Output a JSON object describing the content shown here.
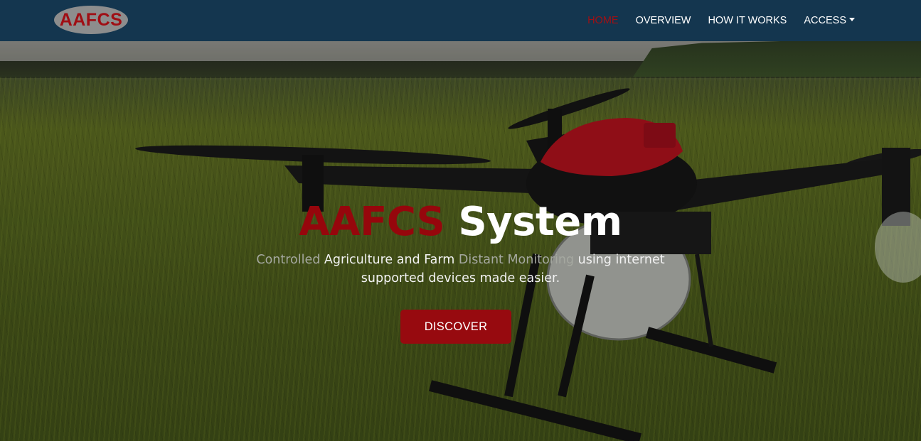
{
  "brand": {
    "logo_text": "AAFCS"
  },
  "nav": {
    "items": [
      {
        "label": "HOME",
        "active": true
      },
      {
        "label": "OVERVIEW",
        "active": false
      },
      {
        "label": "HOW IT WORKS",
        "active": false
      },
      {
        "label": "ACCESS",
        "active": false,
        "dropdown": true
      }
    ]
  },
  "hero": {
    "title_part1": "AAFCS",
    "title_part2": "System",
    "subtitle_segments": [
      {
        "text": "Controlled",
        "style": "dim"
      },
      {
        "text": " Agriculture and Farm ",
        "style": "bright"
      },
      {
        "text": "Distant Monitoring",
        "style": "dim"
      },
      {
        "text": " using internet supported devices made easier.",
        "style": "bright"
      }
    ],
    "button_label": "DISCOVER"
  },
  "colors": {
    "navbar_bg": "#14364f",
    "accent_red": "#970a0f",
    "logo_bg": "#8d8d8d"
  }
}
